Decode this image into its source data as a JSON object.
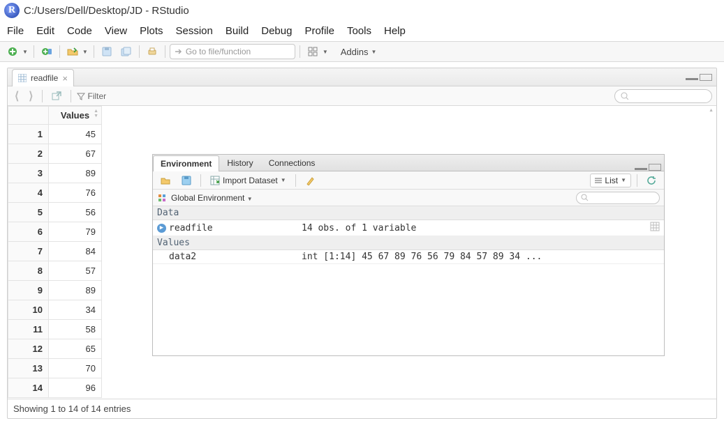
{
  "window": {
    "title": "C:/Users/Dell/Desktop/JD - RStudio"
  },
  "menu": [
    "File",
    "Edit",
    "Code",
    "View",
    "Plots",
    "Session",
    "Build",
    "Debug",
    "Profile",
    "Tools",
    "Help"
  ],
  "toolbar": {
    "goto_placeholder": "Go to file/function",
    "addins": "Addins"
  },
  "source": {
    "tab_name": "readfile",
    "filter_label": "Filter",
    "column_header": "Values",
    "rows": [
      {
        "n": "1",
        "v": "45"
      },
      {
        "n": "2",
        "v": "67"
      },
      {
        "n": "3",
        "v": "89"
      },
      {
        "n": "4",
        "v": "76"
      },
      {
        "n": "5",
        "v": "56"
      },
      {
        "n": "6",
        "v": "79"
      },
      {
        "n": "7",
        "v": "84"
      },
      {
        "n": "8",
        "v": "57"
      },
      {
        "n": "9",
        "v": "89"
      },
      {
        "n": "10",
        "v": "34"
      },
      {
        "n": "11",
        "v": "58"
      },
      {
        "n": "12",
        "v": "65"
      },
      {
        "n": "13",
        "v": "70"
      },
      {
        "n": "14",
        "v": "96"
      }
    ],
    "status": "Showing 1 to 14 of 14 entries"
  },
  "env": {
    "tabs": {
      "environment": "Environment",
      "history": "History",
      "connections": "Connections"
    },
    "import_label": "Import Dataset",
    "list_label": "List",
    "scope_label": "Global Environment",
    "section_data": "Data",
    "section_values": "Values",
    "obj1_name": "readfile",
    "obj1_desc": "14 obs. of 1 variable",
    "obj2_name": "data2",
    "obj2_desc": "int [1:14] 45 67 89 76 56 79 84 57 89 34 ..."
  }
}
